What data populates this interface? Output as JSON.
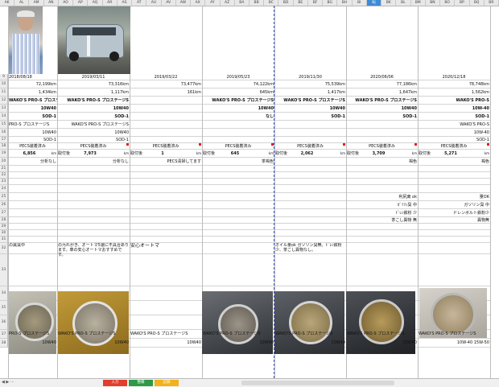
{
  "column_headers": [
    "AK",
    "AL",
    "AM",
    "AN",
    "AO",
    "AP",
    "AQ",
    "AR",
    "AS",
    "AT",
    "AU",
    "AV",
    "AW",
    "AX",
    "AY",
    "AZ",
    "BA",
    "BB",
    "BC",
    "BD",
    "BE",
    "BF",
    "BG",
    "BH",
    "BI",
    "BJ",
    "BK",
    "BL",
    "BM",
    "BN",
    "BO",
    "BP",
    "BQ",
    "BR"
  ],
  "selected_column": "BJ",
  "row_numbers": [
    "9",
    "10",
    "11",
    "12",
    "13",
    "14",
    "15",
    "16",
    "17",
    "18",
    "19",
    "20",
    "21",
    "22",
    "23",
    "24",
    "25",
    "26",
    "27",
    "28",
    "29",
    "30",
    "31",
    "32",
    "33",
    "34",
    "35",
    "36",
    "37",
    "38"
  ],
  "dates": [
    "2018/08/18",
    "2019/03/11",
    "2019/03/22",
    "2019/05/23",
    "2019/11/30",
    "2020/06/06",
    "2020/12/18"
  ],
  "odometer": [
    "72,199km",
    "73,316km",
    "73,477km",
    "74,122km",
    "75,539km",
    "77,186km",
    "78,748km"
  ],
  "distance": [
    "1,434km",
    "1,117km",
    "161km",
    "645km",
    "1,417km",
    "1,647km",
    "1,562km"
  ],
  "oil_brand_bold": [
    "WAKO'S PRO-S プロステージS",
    "WAKO'S PRO-S プロステージS",
    "",
    "WAKO'S PRO-S プロステージS",
    "WAKO'S PRO-S プロステージS",
    "WAKO'S PRO-S プロステージS",
    "WAKO'S PRO-S"
  ],
  "viscosity_bold": [
    "10W40",
    "10W40",
    "",
    "10W40",
    "10W40",
    "10W40",
    "10W-40"
  ],
  "additive_bold": [
    "SOD-1",
    "SOD-1",
    "",
    "なし",
    "SOD-1",
    "SOD-1",
    "SOD-1"
  ],
  "oil_brand_2": [
    "PRO-S プロステージS",
    "WAKO'S PRO-S プロステージS",
    "",
    "",
    "",
    "",
    "WAKO'S PRO-S"
  ],
  "viscosity_2": [
    "10W40",
    "10W40",
    "",
    "",
    "",
    "",
    "10W-40"
  ],
  "additive_2": [
    "SOD-1",
    "SOD-1",
    "",
    "",
    "",
    "",
    "SOD-1"
  ],
  "pecs_label": "PECS装着済み",
  "pecs": [
    "PECS装着済み",
    "PECS装着済み",
    "PECS装着済み",
    "PECS装着済み",
    "PECS装着済み",
    "PECS装着済み",
    "PECS装着済み"
  ],
  "pecs_taken_label": "取付後",
  "pecs_km": [
    "6,856",
    "7,973",
    "1",
    "645",
    "2,062",
    "3,709",
    "5,271"
  ],
  "km_unit": "km",
  "analysis": [
    "分析なし",
    "分析なし",
    "PECS清掃してます",
    "茶褐色",
    "",
    "褐色",
    "褐色"
  ],
  "right_notes_a": [
    "",
    "",
    "",
    "",
    "",
    "利尻東 ok",
    "量OK"
  ],
  "right_notes_b": [
    "",
    "",
    "",
    "",
    "",
    "ｶﾞｿﾘﾝ臭 中",
    "ガソリン臭 中"
  ],
  "right_notes_c": [
    "",
    "",
    "",
    "",
    "",
    "ﾄﾞﾚﾝ鉄粉 少",
    "ドレンボルト鉄粉少"
  ],
  "right_notes_d": [
    "",
    "",
    "",
    "",
    "",
    "茶こし異物 無",
    "異物無"
  ],
  "comments": [
    "の異臭中",
    "の汚れがき、オートマ5速に不具合あります。車の安心オートマおすすめです。",
    "安心オートマ",
    "",
    "オイル量ok ガソリン臭無。ﾄﾞﾚﾝ鉄粉少、茶こし異物なし。",
    "",
    ""
  ],
  "bottom_brand": [
    "PRO-S プロステージS",
    "WAKO'S PRO-S プロステージS",
    "WAKO'S PRO-S プロステージS",
    "WAKO'S PRO-S プロステージS",
    "WAKO'S PRO-S プロステージS",
    "WAKO'S PRO-S プロステージS",
    "WAKO'S PRO-S プロステージS"
  ],
  "bottom_visc": [
    "10W40",
    "10W40",
    "10W40",
    "10W40",
    "10W40",
    "10W40",
    "10W-40 15W-50"
  ],
  "tabs": [
    "入力",
    "整備",
    "記録"
  ],
  "colors": {
    "selected_col": "#3d8bd6",
    "header_bg": "#e8e8e8",
    "red_mark": "#e0201c",
    "tab1": "#e23d2d",
    "tab2": "#2e9a47",
    "tab3": "#f2b21b"
  }
}
